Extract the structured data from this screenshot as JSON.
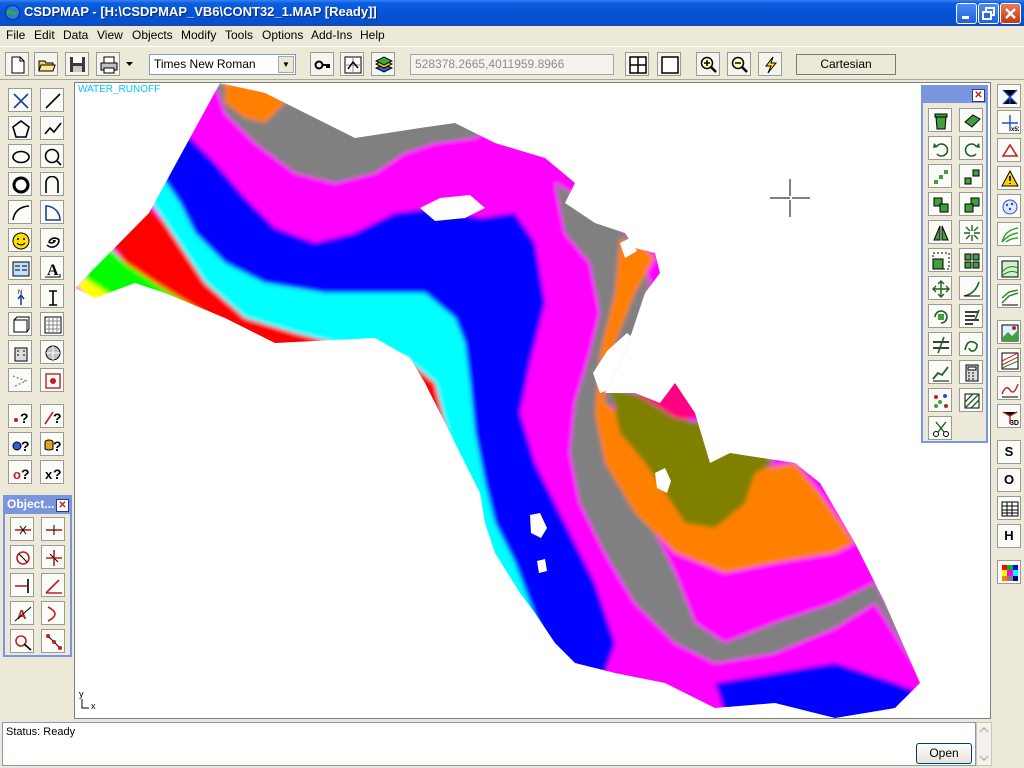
{
  "window": {
    "title": "CSDPMAP - [H:\\CSDPMAP_VB6\\CONT32_1.MAP [Ready]]",
    "minimize_icon": "minimize-icon",
    "maximize_icon": "restore-icon",
    "close_icon": "close-icon"
  },
  "menu": {
    "items": [
      "File",
      "Edit",
      "Data",
      "View",
      "Objects",
      "Modify",
      "Tools",
      "Options",
      "Add-Ins",
      "Help"
    ]
  },
  "toolbar": {
    "font_name": "Times New Roman",
    "coordinates": "528378.2665,4011959.8966",
    "coordinate_system": "Cartesian",
    "icons": [
      "new-file-icon",
      "open-folder-icon",
      "save-icon",
      "print-icon",
      "key-icon",
      "grid-select-icon",
      "layers-icon",
      "tile-view-icon",
      "single-view-icon",
      "zoom-in-icon",
      "zoom-out-icon",
      "lightning-icon"
    ]
  },
  "map": {
    "layer_name": "WATER_RUNOFF",
    "axis_y": "y",
    "axis_x": "x",
    "band_colors": {
      "yellow": "#ffff00",
      "green": "#00ff00",
      "red": "#ff0000",
      "cyan": "#00ffff",
      "blue": "#0000ff",
      "magenta": "#ff00ff",
      "gray": "#808080",
      "orange": "#ff8000",
      "pink": "#ff0080",
      "olive": "#808000"
    }
  },
  "objects_panel": {
    "title": "Object..."
  },
  "right_toolbar": {
    "labels": [
      "S",
      "O",
      "H"
    ]
  },
  "status": {
    "text": "Status: Ready",
    "open_label": "Open"
  }
}
